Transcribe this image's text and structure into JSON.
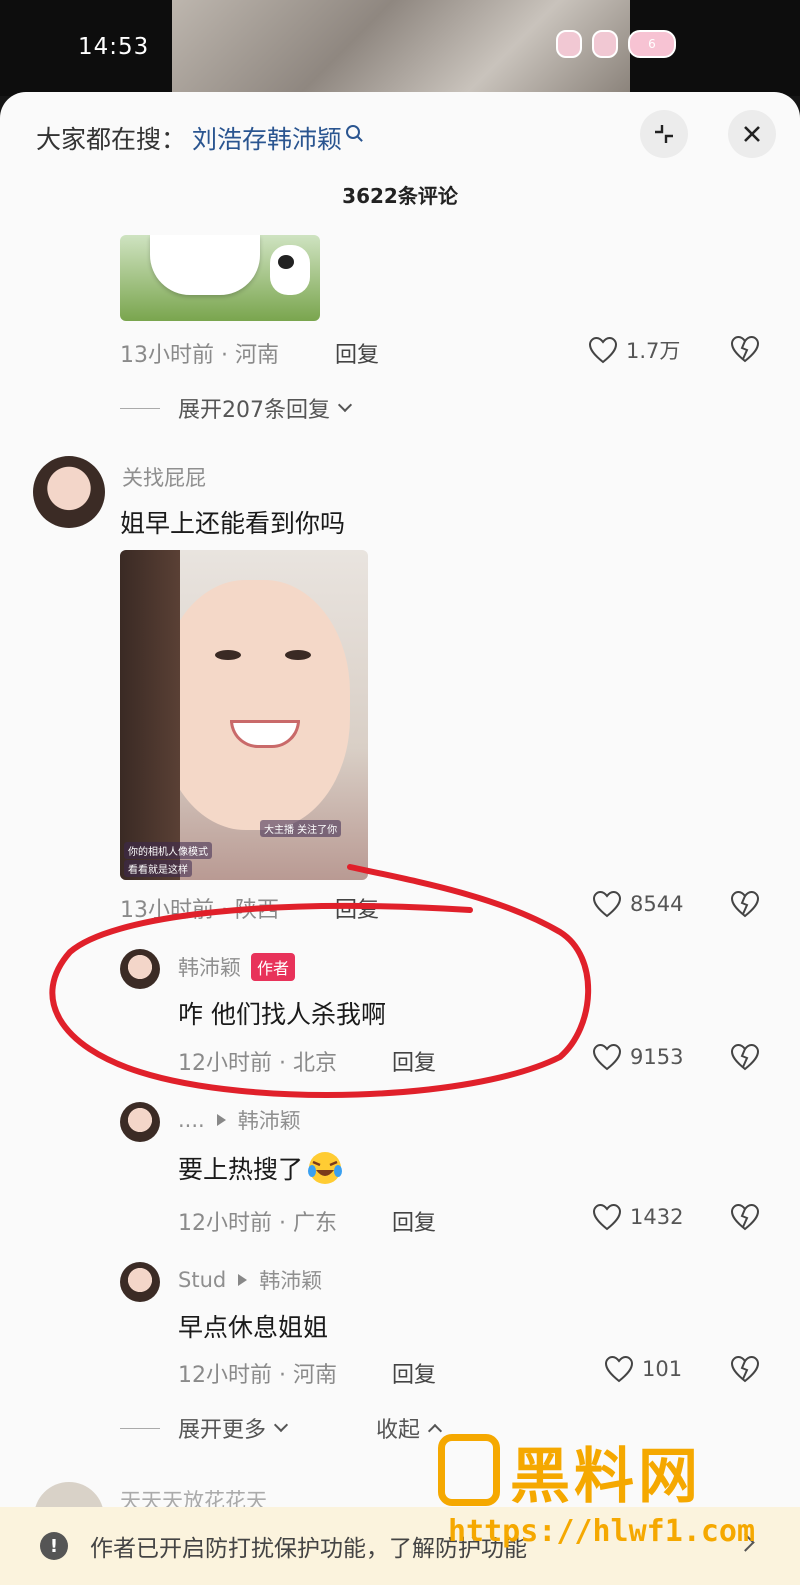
{
  "status_bar": {
    "time": "14:53",
    "battery": "6"
  },
  "header": {
    "search_prefix": "大家都在搜：",
    "search_term": "刘浩存韩沛颖",
    "comment_count": "3622条评论"
  },
  "comment1": {
    "meta": "13小时前 · 河南",
    "reply": "回复",
    "likes": "1.7万",
    "expand": "展开207条回复"
  },
  "comment2": {
    "author": "关找屁屁",
    "text": "姐早上还能看到你吗",
    "photo_caption_1": "大主播 关注了你",
    "photo_caption_2": "你的相机人像模式",
    "photo_caption_3": "看看就是这样",
    "meta": "13小时前 · 陕西",
    "reply": "回复",
    "likes": "8544"
  },
  "reply1": {
    "author": "韩沛颖",
    "tag": "作者",
    "text": "咋 他们找人杀我啊",
    "meta": "12小时前 · 北京",
    "reply": "回复",
    "likes": "9153"
  },
  "reply2": {
    "author": "....",
    "target": "韩沛颖",
    "text": "要上热搜了",
    "meta": "12小时前 · 广东",
    "reply": "回复",
    "likes": "1432"
  },
  "reply3": {
    "author": "Stud",
    "target": "韩沛颖",
    "text": "早点休息姐姐",
    "meta": "12小时前 · 河南",
    "reply": "回复",
    "likes": "101"
  },
  "expand_more": "展开更多",
  "collapse": "收起",
  "next_comment": {
    "author": "天天天放花花天"
  },
  "notice": {
    "text": "作者已开启防打扰保护功能，了解防护功能"
  },
  "watermark": {
    "title": "黑料网",
    "url": "https://hlwf1.com"
  },
  "colors": {
    "link": "#2a5590",
    "author_tag": "#e8325a",
    "circle": "#e0202a",
    "watermark": "#f5a800",
    "notice_bg": "#fbf3dd"
  },
  "icons": [
    "search-icon",
    "collapse-icon",
    "close-icon",
    "heart-icon",
    "broken-heart-icon",
    "chevron-down-icon",
    "chevron-up-icon",
    "info-icon",
    "chevron-right-icon"
  ]
}
